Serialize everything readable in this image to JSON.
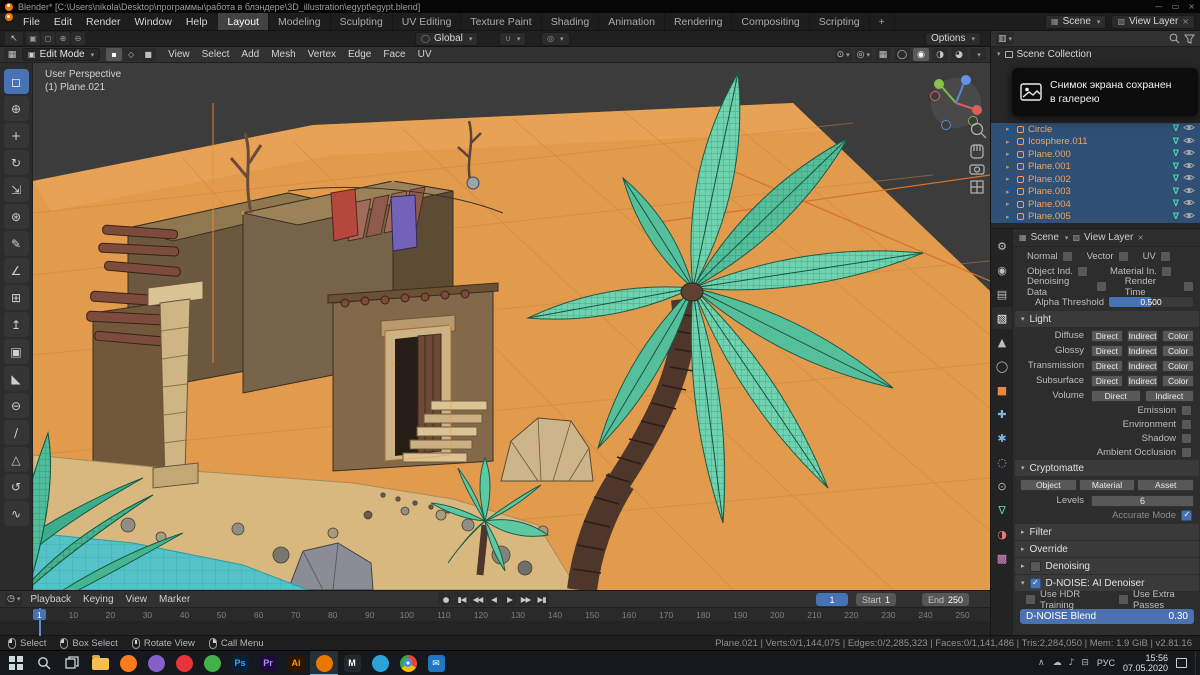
{
  "title_bar": {
    "title": "Blender* [C:\\Users\\nikola\\Desktop\\программы\\работа в блэндере\\3D_illustration\\egypt\\egypt.blend]",
    "minimize": "—",
    "maximize": "▭",
    "close": "×"
  },
  "menu_bar": {
    "app_menus": [
      "File",
      "Edit",
      "Render",
      "Window",
      "Help"
    ],
    "workspaces": [
      "Layout",
      "Modeling",
      "Sculpting",
      "UV Editing",
      "Texture Paint",
      "Shading",
      "Animation",
      "Rendering",
      "Compositing",
      "Scripting"
    ],
    "active_workspace": "Layout",
    "new_workspace": "+",
    "scene_field": "Scene",
    "view_layer_field": "View Layer"
  },
  "tool_settings": {
    "orientation": "Global",
    "options": "Options"
  },
  "viewport_header": {
    "mode": "Edit Mode",
    "menus": [
      "View",
      "Select",
      "Add",
      "Mesh",
      "Vertex",
      "Edge",
      "Face",
      "UV"
    ]
  },
  "toolbar": {
    "tools": [
      {
        "name": "select-box",
        "glyph": "◻",
        "active": true
      },
      {
        "name": "cursor",
        "glyph": "⊕"
      },
      {
        "name": "move",
        "glyph": "+"
      },
      {
        "name": "rotate",
        "glyph": "↻"
      },
      {
        "name": "scale",
        "glyph": "⇲"
      },
      {
        "name": "transform",
        "glyph": "⊛"
      },
      {
        "name": "annotate",
        "glyph": "✎"
      },
      {
        "name": "measure",
        "glyph": "∠"
      },
      {
        "name": "add-cube",
        "glyph": "⊞"
      },
      {
        "name": "extrude-region",
        "glyph": "↥"
      },
      {
        "name": "inset-faces",
        "glyph": "▣"
      },
      {
        "name": "bevel",
        "glyph": "◣"
      },
      {
        "name": "loop-cut",
        "glyph": "⊖"
      },
      {
        "name": "knife",
        "glyph": "∕"
      },
      {
        "name": "poly-build",
        "glyph": "△"
      },
      {
        "name": "spin",
        "glyph": "↺"
      },
      {
        "name": "smooth",
        "glyph": "∿"
      }
    ]
  },
  "viewport": {
    "overlay": {
      "line1": "User Perspective",
      "line2": "(1) Plane.021"
    }
  },
  "outliner": {
    "root": "Scene Collection",
    "items": [
      {
        "name": "Circle"
      },
      {
        "name": "Icosphere.011"
      },
      {
        "name": "Plane.000"
      },
      {
        "name": "Plane.001"
      },
      {
        "name": "Plane.002"
      },
      {
        "name": "Plane.003"
      },
      {
        "name": "Plane.004"
      },
      {
        "name": "Plane.005"
      }
    ]
  },
  "notification": {
    "line1": "Снимок экрана сохранен",
    "line2": "в галерею"
  },
  "properties": {
    "tabs": [
      {
        "name": "tool",
        "glyph": "⚙",
        "color": "#bdbdbd"
      },
      {
        "name": "render",
        "glyph": "◉",
        "color": "#bdbdbd"
      },
      {
        "name": "output",
        "glyph": "▤",
        "color": "#bdbdbd"
      },
      {
        "name": "view-layer",
        "glyph": "▧",
        "color": "#ffffff",
        "active": true
      },
      {
        "name": "scene",
        "glyph": "▲",
        "color": "#bdbdbd"
      },
      {
        "name": "world",
        "glyph": "◯",
        "color": "#bdbdbd"
      },
      {
        "name": "object",
        "glyph": "■",
        "color": "#e9863f"
      },
      {
        "name": "modifiers",
        "glyph": "✚",
        "color": "#7fb2e8"
      },
      {
        "name": "particles",
        "glyph": "✱",
        "color": "#7fb2e8"
      },
      {
        "name": "physics",
        "glyph": "◌",
        "color": "#7fb2e8"
      },
      {
        "name": "constraints",
        "glyph": "⊙",
        "color": "#bdbdbd"
      },
      {
        "name": "object-data",
        "glyph": "∇",
        "color": "#57d0a4"
      },
      {
        "name": "material",
        "glyph": "◑",
        "color": "#e87a7a"
      },
      {
        "name": "texture",
        "glyph": "▩",
        "color": "#e08ad0"
      }
    ],
    "breadcrumb": {
      "scene": "Scene",
      "view_layer": "View Layer"
    },
    "passes": {
      "row1": [
        "Normal",
        "Vector",
        "UV"
      ],
      "row2": [
        "Object Ind.",
        "Material In."
      ],
      "row3": [
        "Denoising Data",
        "Render Time"
      ],
      "alpha_label": "Alpha Threshold",
      "alpha_value": "0.500"
    },
    "light": {
      "title": "Light",
      "rows": [
        {
          "label": "Diffuse",
          "buttons": [
            "Direct",
            "Indirect",
            "Color"
          ]
        },
        {
          "label": "Glossy",
          "buttons": [
            "Direct",
            "Indirect",
            "Color"
          ]
        },
        {
          "label": "Transmission",
          "buttons": [
            "Direct",
            "Indirect",
            "Color"
          ]
        },
        {
          "label": "Subsurface",
          "buttons": [
            "Direct",
            "Indirect",
            "Color"
          ]
        },
        {
          "label": "Volume",
          "buttons": [
            "Direct",
            "Indirect"
          ]
        }
      ],
      "toggles": [
        "Emission",
        "Environment",
        "Shadow",
        "Ambient Occlusion"
      ]
    },
    "cryptomatte": {
      "title": "Cryptomatte",
      "buttons": [
        "Object",
        "Material",
        "Asset"
      ],
      "levels_label": "Levels",
      "levels_value": "6",
      "accurate_label": "Accurate Mode"
    },
    "collapsed": {
      "filter": "Filter",
      "override": "Override",
      "denoising": "Denoising",
      "dnoise": "D-NOISE: AI Denoiser"
    },
    "dnoise": {
      "hdr_label": "Use HDR Training",
      "extra_label": "Use Extra Passes",
      "blend_label": "D-NOISE Blend",
      "blend_value": "0.30"
    }
  },
  "timeline": {
    "menus": [
      "Playback",
      "Keying",
      "View",
      "Marker"
    ],
    "transport": [
      {
        "name": "record",
        "glyph": "●"
      },
      {
        "name": "jump-to-start",
        "glyph": "▮◀"
      },
      {
        "name": "previous-keyframe",
        "glyph": "◀◀"
      },
      {
        "name": "play-reverse",
        "glyph": "◀"
      },
      {
        "name": "play",
        "glyph": "▶"
      },
      {
        "name": "next-keyframe",
        "glyph": "▶▶"
      },
      {
        "name": "jump-to-end",
        "glyph": "▶▮"
      }
    ],
    "current_frame": "1",
    "start_label": "Start",
    "start_value": "1",
    "end_label": "End",
    "end_value": "250",
    "ruler": [
      "1",
      "10",
      "20",
      "30",
      "40",
      "50",
      "60",
      "70",
      "80",
      "90",
      "100",
      "110",
      "120",
      "130",
      "140",
      "150",
      "160",
      "170",
      "180",
      "190",
      "200",
      "210",
      "220",
      "230",
      "240",
      "250"
    ]
  },
  "status_bar": {
    "hints": [
      {
        "label": "Select",
        "mouse": "lmb"
      },
      {
        "label": "Box Select",
        "mouse": "lmb"
      },
      {
        "label": "Rotate View",
        "mouse": "mmb"
      },
      {
        "label": "Call Menu",
        "mouse": "rmb"
      }
    ],
    "stats": "Plane.021 | Verts:0/1,144,075 | Edges:0/2,285,323 | Faces:0/1,141,486 | Tris:2,284,050 | Mem: 1.9 GiB | v2.81.16"
  },
  "taskbar": {
    "apps": [
      {
        "name": "file-explorer",
        "style": "folder"
      },
      {
        "name": "firefox",
        "style": "circle",
        "bg": "#ff7a1a"
      },
      {
        "name": "app-violet",
        "style": "circle",
        "bg": "#8460c8"
      },
      {
        "name": "opera",
        "style": "circle",
        "bg": "#e8323c"
      },
      {
        "name": "app-green",
        "style": "circle",
        "bg": "#43b049"
      },
      {
        "name": "photoshop",
        "style": "square",
        "bg": "#0a1f33",
        "label": "Ps",
        "fg": "#31a8ff"
      },
      {
        "name": "premiere",
        "style": "square",
        "bg": "#1d0b38",
        "label": "Pr",
        "fg": "#b58aff"
      },
      {
        "name": "illustrator",
        "style": "square",
        "bg": "#2b1600",
        "label": "Ai",
        "fg": "#ff9a00"
      },
      {
        "name": "blender",
        "style": "circle",
        "bg": "#ea7600",
        "active": true
      },
      {
        "name": "medibang",
        "style": "square",
        "bg": "#23272e",
        "label": "M",
        "fg": "#ffffff"
      },
      {
        "name": "telegram",
        "style": "circle",
        "bg": "#2ba3d8"
      },
      {
        "name": "chrome",
        "style": "chrome"
      },
      {
        "name": "mail",
        "style": "square",
        "bg": "#1e77c0",
        "label": "✉",
        "fg": "#ffffff"
      }
    ],
    "tray": {
      "chevron": "∧",
      "icons": [
        "☁",
        "♪",
        "⊟"
      ],
      "lang": "РУС",
      "time": "15:56",
      "date": "07.05.2020"
    }
  }
}
